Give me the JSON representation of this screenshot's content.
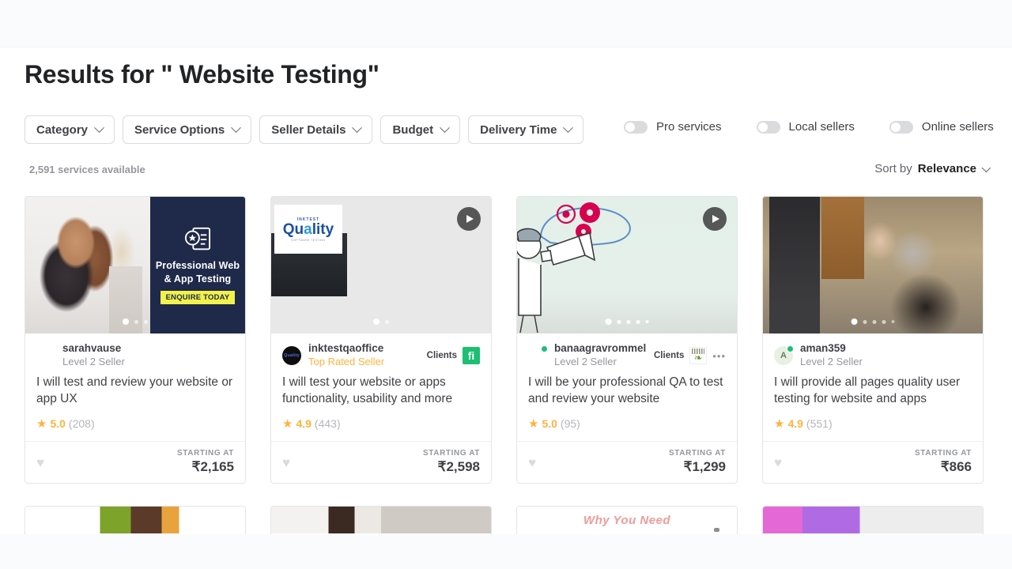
{
  "page": {
    "title": "Results for \" Website Testing\"",
    "results_count": "2,591 services available"
  },
  "filters": [
    {
      "label": "Category",
      "icon": "chevron-down-icon"
    },
    {
      "label": "Service Options",
      "icon": "chevron-down-icon"
    },
    {
      "label": "Seller Details",
      "icon": "chevron-down-icon"
    },
    {
      "label": "Budget",
      "icon": "chevron-down-icon"
    },
    {
      "label": "Delivery Time",
      "icon": "chevron-down-icon"
    }
  ],
  "toggles": [
    {
      "label": "Pro services",
      "state": "off"
    },
    {
      "label": "Local sellers",
      "state": "off"
    },
    {
      "label": "Online sellers",
      "state": "off"
    }
  ],
  "sort": {
    "prefix": "Sort by",
    "value": "Relevance",
    "icon": "chevron-down-icon"
  },
  "labels": {
    "clients": "Clients",
    "starting_at": "STARTING AT",
    "heart": "♥",
    "star": "★",
    "ellipsis": "•••",
    "play": "play-icon"
  },
  "colors": {
    "star": "#ffb33e",
    "top_rated": "#ffb33e",
    "fiverr_green": "#1dbf73",
    "online_dot": "#1dbf73",
    "text_primary": "#404145",
    "text_muted": "#95979d",
    "border": "#e4e5e7"
  },
  "cards": [
    {
      "seller": "sarahvause",
      "level": "Level 2 Seller",
      "online": false,
      "clients_badge": null,
      "title": "I will test and review your website or app UX",
      "rating": "5.0",
      "reviews": "(208)",
      "starting_at": "STARTING AT",
      "price": "₹2,165",
      "media": {
        "type": "image",
        "has_play_button": false,
        "dots_total": 3,
        "dots_active": 1,
        "overlay_text": "Professional Web & App Testing",
        "overlay_cta": "ENQUIRE TODAY"
      }
    },
    {
      "seller": "inktestqaoffice",
      "level": "Top Rated Seller",
      "online": false,
      "clients_badge": "fiverr-fi-logo",
      "title": "I will test your website or apps functionality, usability and more",
      "rating": "4.9",
      "reviews": "(443)",
      "starting_at": "STARTING AT",
      "price": "₹2,598",
      "media": {
        "type": "video",
        "has_play_button": true,
        "dots_total": 2,
        "dots_active": 1,
        "logo_top": "INKTEST",
        "logo_main": "Quality",
        "logo_sub": "SOFTWARE TESTING"
      }
    },
    {
      "seller": "banaagravrommel",
      "level": "Level 2 Seller",
      "online": true,
      "clients_badge": "client-logo-leaf",
      "title": "I will be your professional QA to test and review your website",
      "rating": "5.0",
      "reviews": "(95)",
      "starting_at": "STARTING AT",
      "price": "₹1,299",
      "media": {
        "type": "video",
        "has_play_button": true,
        "dots_total": 5,
        "dots_active": 1
      }
    },
    {
      "seller": "aman359",
      "level": "Level 2 Seller",
      "online": true,
      "clients_badge": null,
      "title": "I will provide all pages quality user testing for website and apps",
      "rating": "4.9",
      "reviews": "(551)",
      "starting_at": "STARTING AT",
      "price": "₹866",
      "media": {
        "type": "image",
        "has_play_button": false,
        "dots_total": 5,
        "dots_active": 1
      }
    }
  ],
  "next_row": {
    "card3_text": "Why You Need"
  }
}
